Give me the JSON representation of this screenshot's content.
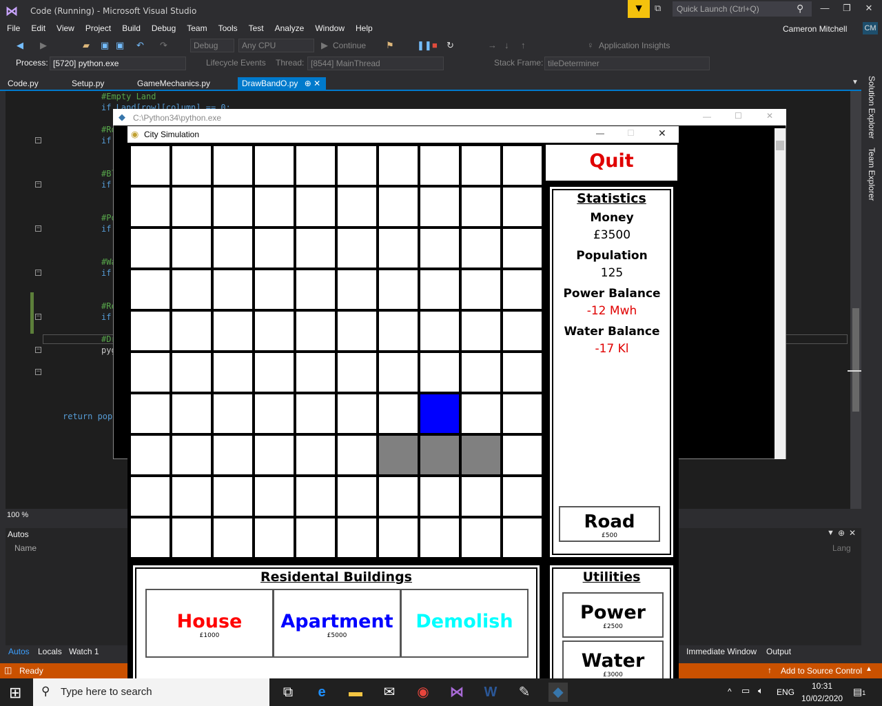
{
  "vs": {
    "title": "Code (Running) - Microsoft Visual Studio",
    "quick_launch_placeholder": "Quick Launch (Ctrl+Q)",
    "user": "Cameron Mitchell",
    "user_initials": "CM",
    "menu": [
      "File",
      "Edit",
      "View",
      "Project",
      "Build",
      "Debug",
      "Team",
      "Tools",
      "Test",
      "Analyze",
      "Window",
      "Help"
    ],
    "toolbar": {
      "config": "Debug",
      "platform": "Any CPU",
      "continue": "Continue",
      "app_insights": "Application Insights"
    },
    "toolbar2": {
      "process_label": "Process:",
      "process_value": "[5720] python.exe",
      "lifecycle": "Lifecycle Events",
      "thread_label": "Thread:",
      "thread_value": "[8544] MainThread",
      "stack_label": "Stack Frame:",
      "stack_value": "tileDeterminer"
    },
    "tabs": [
      "Code.py",
      "Setup.py",
      "GameMechanics.py",
      "DrawBandO.py"
    ],
    "active_tab": "DrawBandO.py",
    "code_lines": [
      {
        "text": "#Empty Land",
        "type": "comment"
      },
      {
        "text": "if Land[row][column] == 0:",
        "type": "kw"
      },
      {
        "text": "#Ro",
        "type": "comment"
      },
      {
        "text": "if",
        "type": "kw"
      },
      {
        "text": "#Bl",
        "type": "comment"
      },
      {
        "text": "if",
        "type": "kw"
      },
      {
        "text": "#Po",
        "type": "comment"
      },
      {
        "text": "if",
        "type": "kw"
      },
      {
        "text": "#Wa",
        "type": "comment"
      },
      {
        "text": "if",
        "type": "kw"
      },
      {
        "text": "#Re",
        "type": "comment"
      },
      {
        "text": "if",
        "type": "kw"
      },
      {
        "text": "#Dr",
        "type": "comment"
      },
      {
        "text": "pyg",
        "type": "comment"
      },
      {
        "text": "return popu",
        "type": "kw"
      }
    ],
    "zoom": "100 %",
    "autos_title": "Autos",
    "autos_name_col": "Name",
    "autos_lang_col": "Lang",
    "bottom_tabs_left": [
      "Autos",
      "Locals",
      "Watch 1"
    ],
    "bottom_tabs_right": [
      "Immediate Window",
      "Output"
    ],
    "status": "Ready",
    "source_control": "Add to Source Control",
    "side_panels": [
      "Solution Explorer",
      "Team Explorer"
    ]
  },
  "console": {
    "title": "C:\\Python34\\python.exe"
  },
  "game": {
    "window_title": "City Simulation",
    "quit_label": "Quit",
    "statistics_title": "Statistics",
    "stats": [
      {
        "label": "Money",
        "value": "£3500",
        "color": "#000000"
      },
      {
        "label": "Population",
        "value": "125",
        "color": "#000000"
      },
      {
        "label": "Power Balance",
        "value": "-12 Mwh",
        "color": "#e00000"
      },
      {
        "label": "Water Balance",
        "value": "-17 Kl",
        "color": "#e00000"
      }
    ],
    "road": {
      "label": "Road",
      "price": "£500"
    },
    "residential_title": "Residental Buildings",
    "residential": [
      {
        "label": "House",
        "price": "£1000",
        "color": "#ff0000"
      },
      {
        "label": "Apartment",
        "price": "£5000",
        "color": "#0000ff"
      },
      {
        "label": "Demolish",
        "price": "",
        "color": "#00ffff"
      }
    ],
    "utilities_title": "Utilities",
    "utilities": [
      {
        "label": "Power",
        "price": "£2500"
      },
      {
        "label": "Water",
        "price": "£3000"
      }
    ],
    "grid_rows": 10,
    "grid_cols": 10,
    "special_cells": [
      {
        "row": 6,
        "col": 7,
        "type": "blue",
        "color": "#0000ff"
      },
      {
        "row": 7,
        "col": 6,
        "type": "road",
        "color": "#808080"
      },
      {
        "row": 7,
        "col": 7,
        "type": "road",
        "color": "#808080"
      },
      {
        "row": 7,
        "col": 8,
        "type": "road",
        "color": "#808080"
      }
    ]
  },
  "taskbar": {
    "search_placeholder": "Type here to search",
    "language": "ENG",
    "time": "10:31",
    "date": "10/02/2020",
    "notification_count": "1"
  }
}
